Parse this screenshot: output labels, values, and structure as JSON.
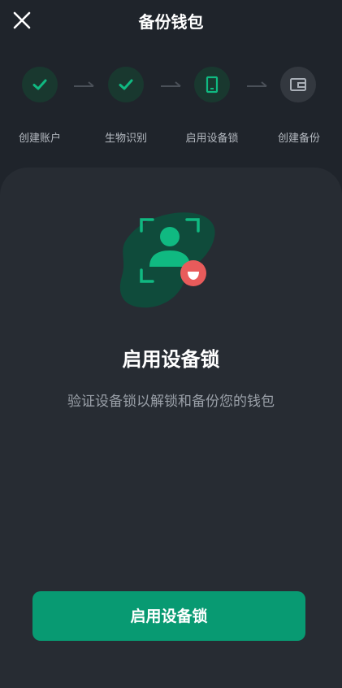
{
  "header": {
    "title": "备份钱包",
    "close_icon": "close-icon"
  },
  "stepper": {
    "steps": [
      {
        "label": "创建账户",
        "state": "done",
        "icon": "check-icon"
      },
      {
        "label": "生物识别",
        "state": "done",
        "icon": "check-icon"
      },
      {
        "label": "启用设备锁",
        "state": "current",
        "icon": "phone-icon"
      },
      {
        "label": "创建备份",
        "state": "todo",
        "icon": "wallet-icon"
      }
    ]
  },
  "main": {
    "illustration_icon": "face-scan-icon",
    "headline": "启用设备锁",
    "subtitle": "验证设备锁以解锁和备份您的钱包"
  },
  "footer": {
    "primary_button_label": "启用设备锁"
  },
  "colors": {
    "background": "#1f242b",
    "card": "#272c33",
    "accent": "#089a72",
    "accent_dark": "#19382f",
    "badge": "#e85b5b"
  }
}
